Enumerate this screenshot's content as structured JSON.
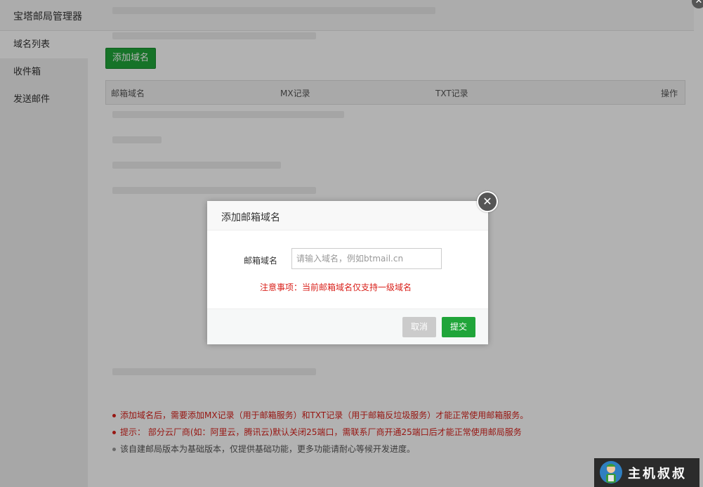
{
  "app": {
    "title": "宝塔邮局管理器",
    "window_close_glyph": "✕"
  },
  "sidebar": {
    "items": [
      {
        "label": "域名列表",
        "active": true
      },
      {
        "label": "收件箱",
        "active": false
      },
      {
        "label": "发送邮件",
        "active": false
      }
    ]
  },
  "main": {
    "add_button": "添加域名",
    "table": {
      "headers": [
        "邮箱域名",
        "MX记录",
        "TXT记录",
        "操作"
      ]
    },
    "tips": [
      "添加域名后，需要添加MX记录（用于邮箱服务）和TXT记录（用于邮箱反垃圾服务）才能正常使用邮箱服务。",
      "提示： 部分云厂商(如：阿里云，腾讯云)默认关闭25端口，需联系厂商开通25端口后才能正常使用邮局服务",
      "该自建邮局版本为基础版本，仅提供基础功能，更多功能请耐心等候开发进度。"
    ]
  },
  "dialog": {
    "title": "添加邮箱域名",
    "close_glyph": "✕",
    "field_label": "邮箱域名",
    "field_value": "",
    "field_placeholder": "请输入域名，例如btmail.cn",
    "notice": "注意事项：当前邮箱域名仅支持一级域名",
    "cancel_label": "取消",
    "submit_label": "提交"
  },
  "watermark": {
    "text": "主机叔叔"
  },
  "colors": {
    "accent": "#20a53a",
    "warning": "#d9221c",
    "cancel": "#cbcbcb"
  }
}
